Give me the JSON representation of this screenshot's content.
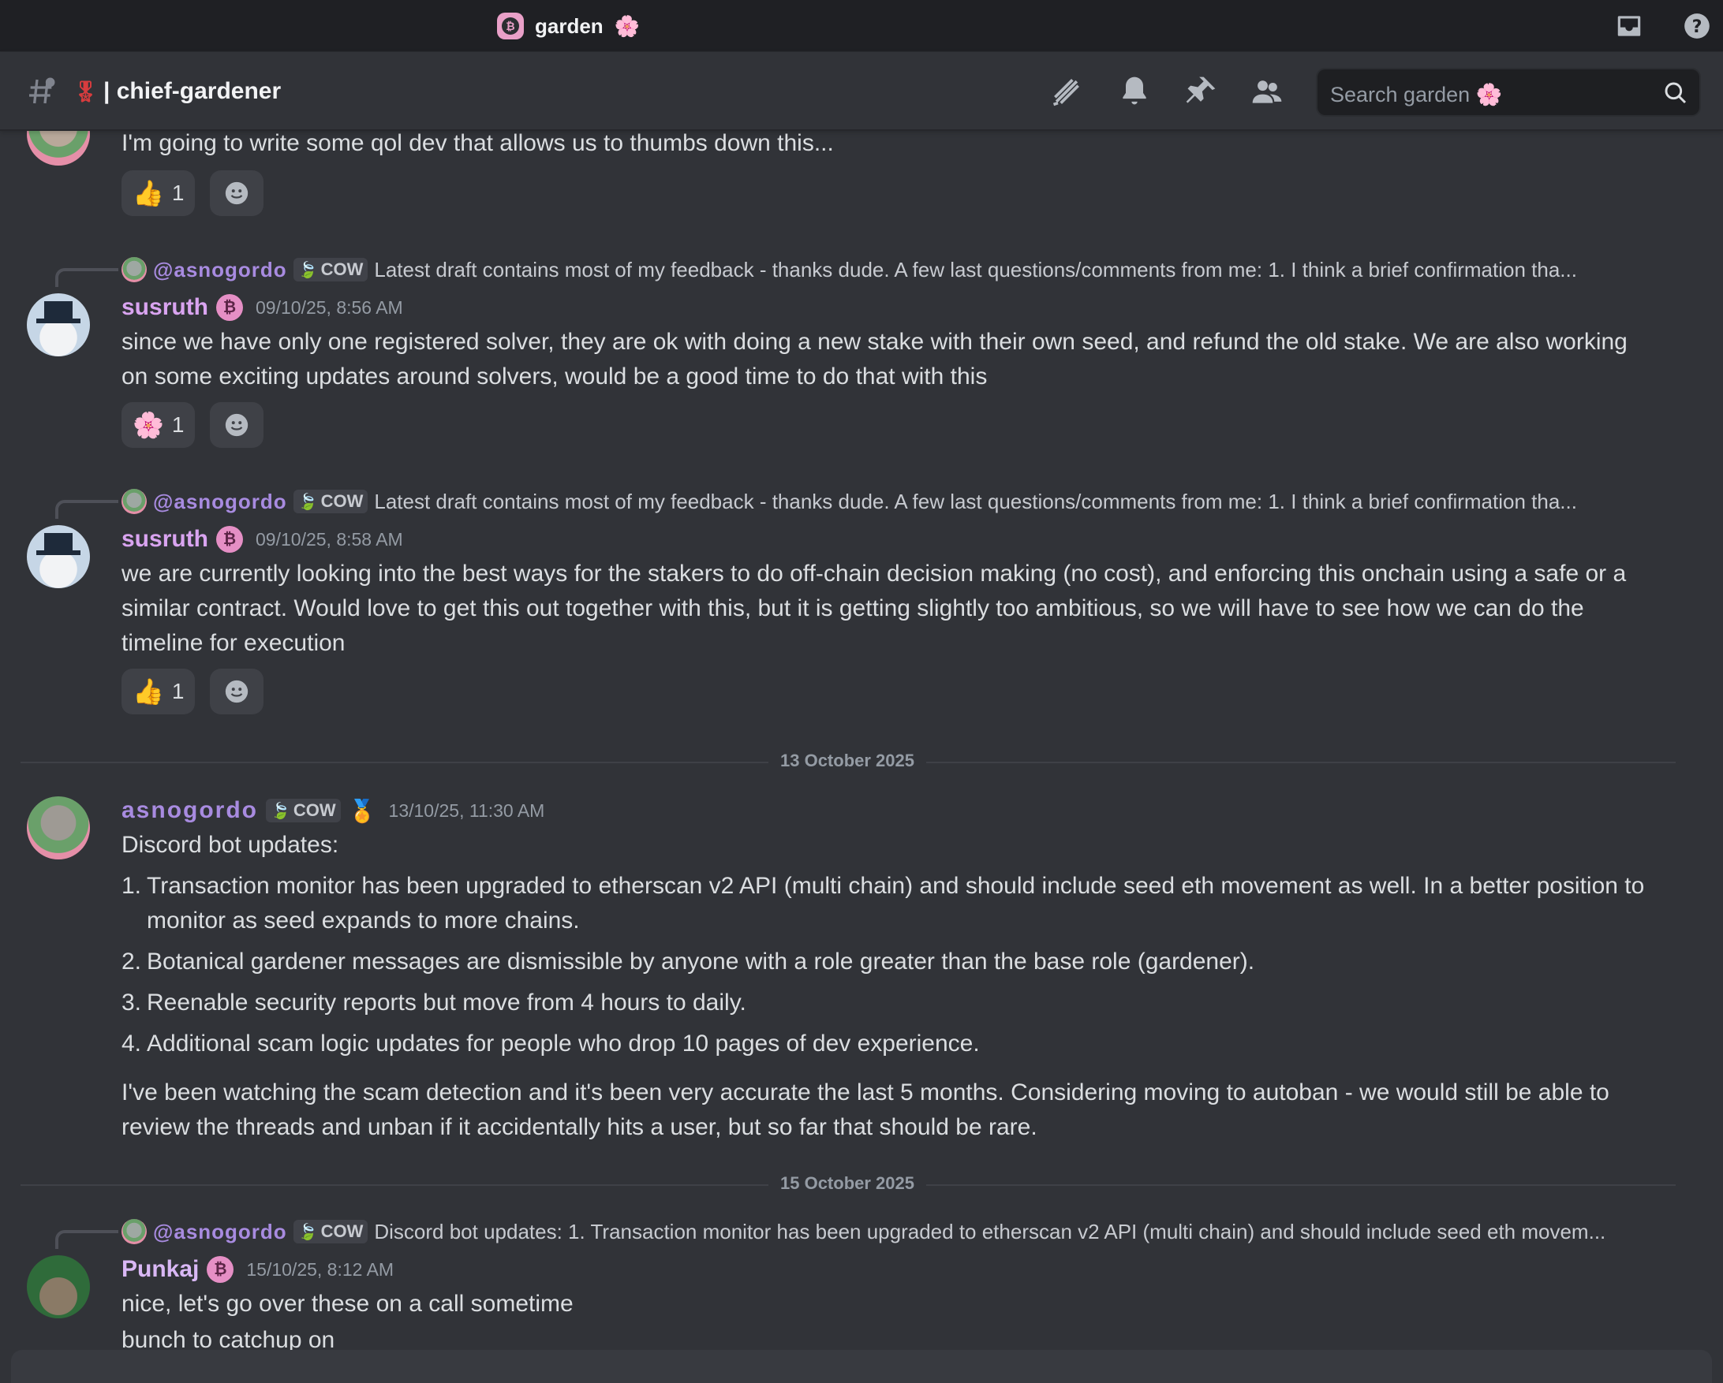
{
  "titlebar": {
    "server_name": "garden",
    "server_emoji": "🌸",
    "icons": [
      "inbox-icon",
      "help-icon"
    ]
  },
  "header": {
    "channel_prefix": "🎖",
    "channel_name": "| chief-gardener",
    "search_placeholder": "Search garden 🌸",
    "icons": [
      "threads-icon",
      "bell-icon",
      "pin-icon",
      "members-icon",
      "search-icon"
    ]
  },
  "messages": {
    "m0": {
      "text": "I'm going to write some qol dev that allows us to thumbs down this...",
      "reaction": {
        "emoji": "👍",
        "count": "1"
      }
    },
    "m1": {
      "reply_mention": "@asnogordo",
      "reply_tag": "COW",
      "reply_text": "Latest draft contains most of my feedback - thanks dude.   A few last questions/comments from me: 1. I think a brief confirmation tha...",
      "author": "susruth",
      "timestamp": "09/10/25, 8:56 AM",
      "text": "since we have only one registered solver, they are ok with doing a new stake with their own seed, and refund the old stake. We are also working on some exciting updates around solvers, would be a good time to do that with this",
      "reaction": {
        "emoji": "🌸",
        "count": "1"
      }
    },
    "m2": {
      "reply_mention": "@asnogordo",
      "reply_tag": "COW",
      "reply_text": "Latest draft contains most of my feedback - thanks dude.   A few last questions/comments from me: 1. I think a brief confirmation tha...",
      "author": "susruth",
      "timestamp": "09/10/25, 8:58 AM",
      "text": "we are currently looking into the best ways for the stakers to do off-chain decision making (no cost), and enforcing this onchain using a safe or a similar contract. Would love to get this out together with this, but it is getting slightly too ambitious, so we will have to see how we can do the timeline for execution",
      "reaction": {
        "emoji": "👍",
        "count": "1"
      }
    },
    "date1": "13 October 2025",
    "m3": {
      "author": "asnogordo",
      "tag": "COW",
      "timestamp": "13/10/25, 11:30 AM",
      "intro": "Discord bot updates:",
      "items": [
        {
          "num": "1.",
          "text": "Transaction monitor has been upgraded to etherscan v2 API (multi chain) and should include seed eth movement as well. In a better position to monitor as seed expands to more chains."
        },
        {
          "num": "2.",
          "text": "Botanical gardener messages are dismissible by anyone with a role greater than the base role (gardener)."
        },
        {
          "num": "3.",
          "text": "Reenable security reports but move from 4 hours to daily."
        },
        {
          "num": "4.",
          "text": "Additional scam logic updates for people who drop 10 pages of dev experience."
        }
      ],
      "outro": "I've been watching the scam detection and it's been very accurate the last 5 months. Considering moving to autoban - we would still be able to review the threads and unban if it accidentally hits a user, but so far that should be rare."
    },
    "date2": "15 October 2025",
    "m4": {
      "reply_mention": "@asnogordo",
      "reply_tag": "COW",
      "reply_text": "Discord bot updates: 1. Transaction monitor has been upgraded to etherscan v2 API (multi chain) and should include seed eth movem...",
      "author": "Punkaj",
      "timestamp": "15/10/25, 8:12 AM",
      "text1": "nice, let's go over these on a call sometime",
      "text2": "bunch to catchup on"
    }
  }
}
